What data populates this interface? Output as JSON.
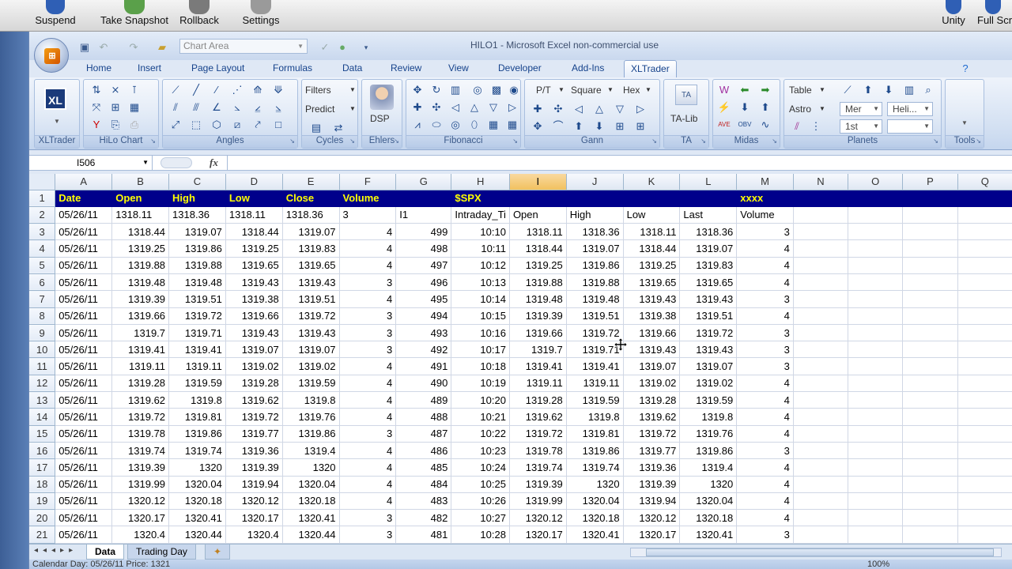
{
  "host_toolbar": {
    "buttons": [
      "Suspend",
      "Take Snapshot",
      "Rollback",
      "Settings"
    ],
    "right_buttons": [
      "Unity",
      "Full Scr"
    ]
  },
  "window": {
    "title": "HILO1 - Microsoft Excel non-commercial use",
    "name_combo_placeholder": "Chart Area"
  },
  "tabs": [
    "Home",
    "Insert",
    "Page Layout",
    "Formulas",
    "Data",
    "Review",
    "View",
    "Developer",
    "Add-Ins",
    "XLTrader"
  ],
  "active_tab": "XLTrader",
  "ribbon": {
    "groups": [
      "XLTrader",
      "HiLo Chart",
      "Angles",
      "Cycles",
      "Ehlers",
      "Fibonacci",
      "Gann",
      "TA",
      "Midas",
      "Planets",
      "Tools"
    ],
    "cycles_buttons": [
      "Filters",
      "Predict"
    ],
    "ehlers_button": "DSP",
    "gann_dropdowns": [
      "P/T",
      "Square",
      "Hex"
    ],
    "ta_button": "TA-Lib",
    "planets_items": [
      "Table",
      "Astro"
    ],
    "planets_dropdowns": [
      "Mer",
      "1st",
      "Heli..."
    ],
    "xltrader_logo": "XL"
  },
  "formula_bar": {
    "name_box": "I506",
    "fx": "fx",
    "formula": ""
  },
  "columns": [
    "A",
    "B",
    "C",
    "D",
    "E",
    "F",
    "G",
    "H",
    "I",
    "J",
    "K",
    "L",
    "M",
    "N",
    "O",
    "P",
    "Q"
  ],
  "selected_column": "I",
  "row1": [
    "Date",
    "Open",
    "High",
    "Low",
    "Close",
    "Volume",
    "",
    "$SPX",
    "",
    "",
    "",
    "",
    "xxxx",
    "",
    "",
    "",
    ""
  ],
  "row2": [
    "05/26/11",
    "1318.11",
    "1318.36",
    "1318.11",
    "1318.36",
    "3",
    "I1",
    "Intraday_Ti",
    "Open",
    "High",
    "Low",
    "Last",
    "Volume",
    "",
    "",
    "",
    ""
  ],
  "rows": [
    [
      "05/26/11",
      "1318.44",
      "1319.07",
      "1318.44",
      "1319.07",
      "4",
      "499",
      "10:10",
      "1318.11",
      "1318.36",
      "1318.11",
      "1318.36",
      "3"
    ],
    [
      "05/26/11",
      "1319.25",
      "1319.86",
      "1319.25",
      "1319.83",
      "4",
      "498",
      "10:11",
      "1318.44",
      "1319.07",
      "1318.44",
      "1319.07",
      "4"
    ],
    [
      "05/26/11",
      "1319.88",
      "1319.88",
      "1319.65",
      "1319.65",
      "4",
      "497",
      "10:12",
      "1319.25",
      "1319.86",
      "1319.25",
      "1319.83",
      "4"
    ],
    [
      "05/26/11",
      "1319.48",
      "1319.48",
      "1319.43",
      "1319.43",
      "3",
      "496",
      "10:13",
      "1319.88",
      "1319.88",
      "1319.65",
      "1319.65",
      "4"
    ],
    [
      "05/26/11",
      "1319.39",
      "1319.51",
      "1319.38",
      "1319.51",
      "4",
      "495",
      "10:14",
      "1319.48",
      "1319.48",
      "1319.43",
      "1319.43",
      "3"
    ],
    [
      "05/26/11",
      "1319.66",
      "1319.72",
      "1319.66",
      "1319.72",
      "3",
      "494",
      "10:15",
      "1319.39",
      "1319.51",
      "1319.38",
      "1319.51",
      "4"
    ],
    [
      "05/26/11",
      "1319.7",
      "1319.71",
      "1319.43",
      "1319.43",
      "3",
      "493",
      "10:16",
      "1319.66",
      "1319.72",
      "1319.66",
      "1319.72",
      "3"
    ],
    [
      "05/26/11",
      "1319.41",
      "1319.41",
      "1319.07",
      "1319.07",
      "3",
      "492",
      "10:17",
      "1319.7",
      "1319.71",
      "1319.43",
      "1319.43",
      "3"
    ],
    [
      "05/26/11",
      "1319.11",
      "1319.11",
      "1319.02",
      "1319.02",
      "4",
      "491",
      "10:18",
      "1319.41",
      "1319.41",
      "1319.07",
      "1319.07",
      "3"
    ],
    [
      "05/26/11",
      "1319.28",
      "1319.59",
      "1319.28",
      "1319.59",
      "4",
      "490",
      "10:19",
      "1319.11",
      "1319.11",
      "1319.02",
      "1319.02",
      "4"
    ],
    [
      "05/26/11",
      "1319.62",
      "1319.8",
      "1319.62",
      "1319.8",
      "4",
      "489",
      "10:20",
      "1319.28",
      "1319.59",
      "1319.28",
      "1319.59",
      "4"
    ],
    [
      "05/26/11",
      "1319.72",
      "1319.81",
      "1319.72",
      "1319.76",
      "4",
      "488",
      "10:21",
      "1319.62",
      "1319.8",
      "1319.62",
      "1319.8",
      "4"
    ],
    [
      "05/26/11",
      "1319.78",
      "1319.86",
      "1319.77",
      "1319.86",
      "3",
      "487",
      "10:22",
      "1319.72",
      "1319.81",
      "1319.72",
      "1319.76",
      "4"
    ],
    [
      "05/26/11",
      "1319.74",
      "1319.74",
      "1319.36",
      "1319.4",
      "4",
      "486",
      "10:23",
      "1319.78",
      "1319.86",
      "1319.77",
      "1319.86",
      "3"
    ],
    [
      "05/26/11",
      "1319.39",
      "1320",
      "1319.39",
      "1320",
      "4",
      "485",
      "10:24",
      "1319.74",
      "1319.74",
      "1319.36",
      "1319.4",
      "4"
    ],
    [
      "05/26/11",
      "1319.99",
      "1320.04",
      "1319.94",
      "1320.04",
      "4",
      "484",
      "10:25",
      "1319.39",
      "1320",
      "1319.39",
      "1320",
      "4"
    ],
    [
      "05/26/11",
      "1320.12",
      "1320.18",
      "1320.12",
      "1320.18",
      "4",
      "483",
      "10:26",
      "1319.99",
      "1320.04",
      "1319.94",
      "1320.04",
      "4"
    ],
    [
      "05/26/11",
      "1320.17",
      "1320.41",
      "1320.17",
      "1320.41",
      "3",
      "482",
      "10:27",
      "1320.12",
      "1320.18",
      "1320.12",
      "1320.18",
      "4"
    ],
    [
      "05/26/11",
      "1320.4",
      "1320.44",
      "1320.4",
      "1320.44",
      "3",
      "481",
      "10:28",
      "1320.17",
      "1320.41",
      "1320.17",
      "1320.41",
      "3"
    ]
  ],
  "sheet_tabs": [
    "Data",
    "Trading Day"
  ],
  "active_sheet": "Data",
  "status_bar": "Calendar Day: 05/26/11 Price: 1321",
  "zoom": "100%",
  "colors": {
    "header_fill": "#00008b",
    "header_text": "#ffff00",
    "selection": "#f5c65f"
  }
}
